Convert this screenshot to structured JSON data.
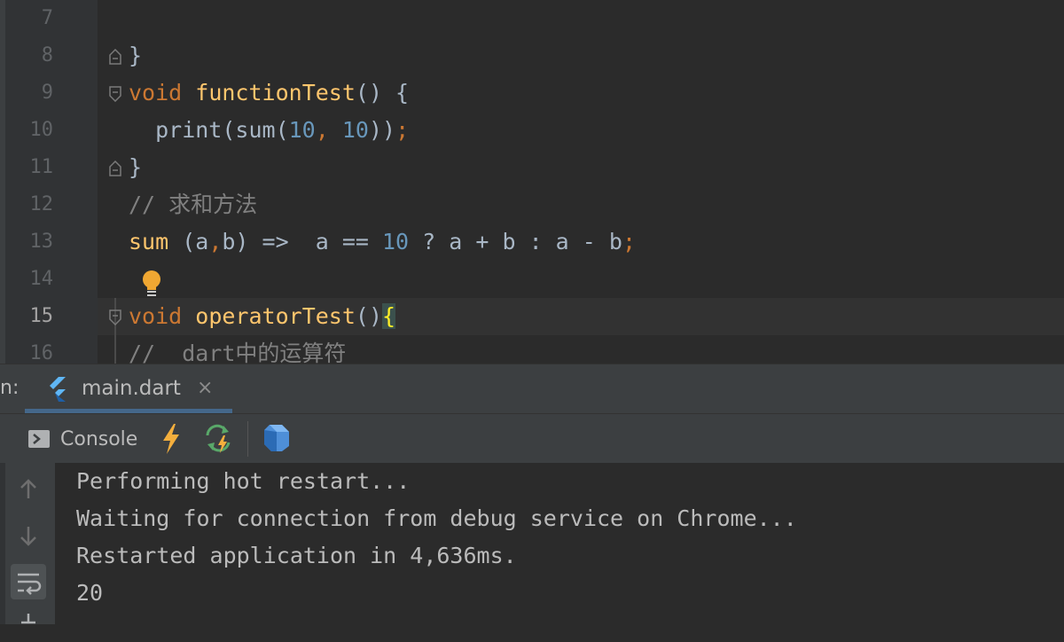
{
  "editor": {
    "line_numbers": [
      "7",
      "8",
      "9",
      "10",
      "11",
      "12",
      "13",
      "14",
      "15",
      "16"
    ],
    "current_line": "15",
    "code": {
      "line8": {
        "brace": "}"
      },
      "line9": {
        "kw": "void",
        "fn": "functionTest",
        "rest": "() {"
      },
      "line10": {
        "pre": "  print(sum(",
        "n1": "10",
        "comma": ", ",
        "n2": "10",
        "post": "))",
        "semi": ";"
      },
      "line11": {
        "brace": "}"
      },
      "line12": {
        "comment": "// 求和方法"
      },
      "line13": {
        "fn": "sum",
        "mid": " (a",
        "comma": ",",
        "mid2": "b) =>  a == ",
        "num": "10",
        "rest": " ? a + b : a - b",
        "semi": ";"
      },
      "line15": {
        "kw": "void",
        "fn": "operatorTest",
        "rest": "()",
        "brace": "{"
      },
      "line16": {
        "comment": "//  dart中的运算符"
      }
    }
  },
  "tool_window": {
    "prefix": "n:",
    "tab": {
      "label": "main.dart",
      "close": "×"
    },
    "toolbar": {
      "console_label": "Console"
    },
    "output": [
      "Performing hot restart...",
      "Waiting for connection from debug service on Chrome...",
      "Restarted application in 4,636ms.",
      "20"
    ]
  },
  "icons": {
    "fold": "fold-marker-icon",
    "bulb": "lightbulb-icon",
    "flutter": "flutter-icon",
    "console": "console-icon",
    "hot_reload": "hot-reload-icon",
    "hot_restart": "hot-restart-icon",
    "devtools": "dart-devtools-icon",
    "up": "arrow-up-icon",
    "down": "arrow-down-icon",
    "wrap": "soft-wrap-icon",
    "scroll_end": "scroll-to-end-icon"
  },
  "colors": {
    "editor_bg": "#2b2b2b",
    "keyword": "#cc7832",
    "function": "#ffc66d",
    "number": "#6897bb",
    "comment": "#808080",
    "text": "#a9b7c6",
    "accent": "#4a88c7"
  }
}
